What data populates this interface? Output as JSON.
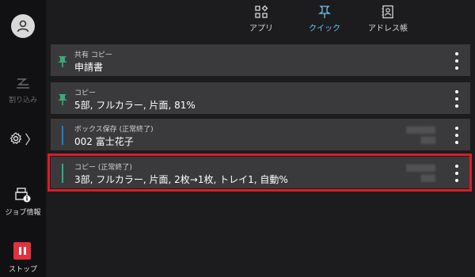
{
  "rail": {
    "avatar_icon": "user-icon",
    "interrupt_label": "割り込み",
    "settings_chevron": "〉",
    "job_info_label": "ジョブ情報",
    "stop_label": "ストップ"
  },
  "tabs": [
    {
      "label": "アプリ",
      "icon": "apps-icon",
      "active": false
    },
    {
      "label": "クイック",
      "icon": "pin-icon",
      "active": true
    },
    {
      "label": "アドレス帳",
      "icon": "address-book-icon",
      "active": false
    }
  ],
  "jobs": [
    {
      "category": "共有 コピー",
      "title": "申請書",
      "marker": "pin",
      "timestamp": ""
    },
    {
      "category": "コピー",
      "title": "5部, フルカラー, 片面, 81%",
      "marker": "pin",
      "timestamp": ""
    },
    {
      "category": "ボックス保存 (正常終了)",
      "title": "002 富士花子",
      "marker": "bar",
      "timestamp": ""
    },
    {
      "category": "コピー (正常終了)",
      "title": "3部, フルカラー, 片面, 2枚→1枚, トレイ1, 自動%",
      "marker": "bar",
      "timestamp": "",
      "selected": true
    }
  ],
  "colors": {
    "accent": "#6fc0ea",
    "pin_green": "#3aaa78",
    "bar_blue": "#1a7fd4",
    "bar_green": "#2fae7e",
    "highlight_red": "#d81e2a",
    "stop_red": "#e3313c"
  }
}
